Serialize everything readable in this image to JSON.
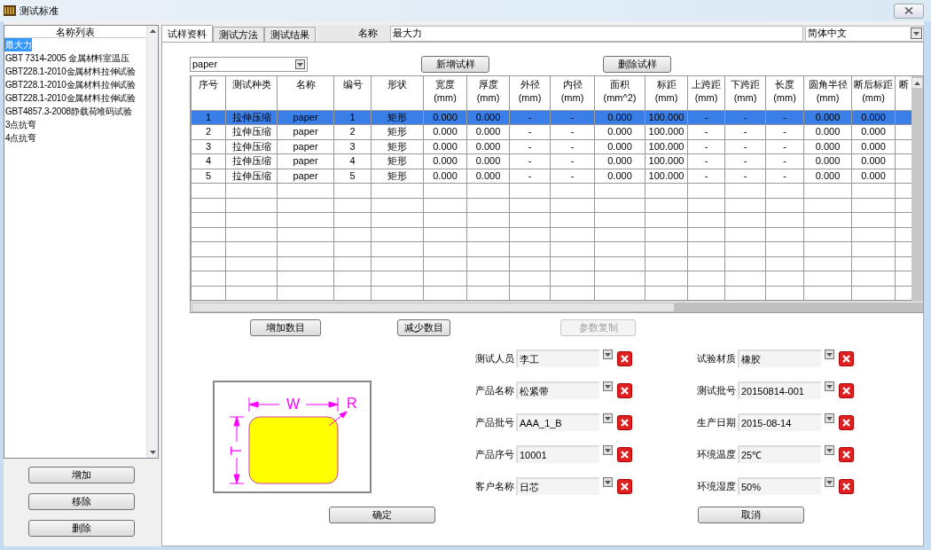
{
  "window": {
    "title": "测试标准"
  },
  "name_list": {
    "header": "名称列表",
    "items": [
      {
        "label": "最大力",
        "selected": true
      },
      {
        "label": "GBT 7314-2005 金属材料室温压",
        "selected": false
      },
      {
        "label": "GBT228.1-2010金属材料拉伸试验",
        "selected": false
      },
      {
        "label": "GBT228.1-2010金属材料拉伸试验",
        "selected": false
      },
      {
        "label": "GBT228.1-2010金属材料拉伸试验",
        "selected": false
      },
      {
        "label": "GBT4857.3-2008静载荷堆码试验",
        "selected": false
      },
      {
        "label": "3点抗弯",
        "selected": false
      },
      {
        "label": "4点抗弯",
        "selected": false
      }
    ]
  },
  "side_buttons": [
    "增加",
    "移除",
    "删除"
  ],
  "tabs": [
    {
      "label": "试样资料",
      "selected": true
    },
    {
      "label": "测试方法",
      "selected": false
    },
    {
      "label": "测试结果",
      "selected": false
    }
  ],
  "name_field": {
    "label": "名称",
    "value": "最大力"
  },
  "language": {
    "value": "简体中文"
  },
  "sample_select": {
    "value": "paper"
  },
  "sample_buttons": [
    "新增试样",
    "删除试样"
  ],
  "table": {
    "columns": [
      {
        "label": "序号"
      },
      {
        "label": "测试种类"
      },
      {
        "label": "名称"
      },
      {
        "label": "编号"
      },
      {
        "label": "形状"
      },
      {
        "label": "宽度",
        "unit": "(mm)"
      },
      {
        "label": "厚度",
        "unit": "(mm)"
      },
      {
        "label": "外径",
        "unit": "(mm)"
      },
      {
        "label": "内径",
        "unit": "(mm)"
      },
      {
        "label": "面积",
        "unit": "(mm^2)"
      },
      {
        "label": "标距",
        "unit": "(mm)"
      },
      {
        "label": "上跨距",
        "unit": "(mm)"
      },
      {
        "label": "下跨距",
        "unit": "(mm)"
      },
      {
        "label": "长度",
        "unit": "(mm)"
      },
      {
        "label": "圆角半径",
        "unit": "(mm)"
      },
      {
        "label": "断后标距",
        "unit": "(mm)"
      },
      {
        "label": "断"
      }
    ],
    "rows": [
      {
        "selected": true,
        "cells": [
          "1",
          "拉伸压缩",
          "paper",
          "1",
          "矩形",
          "0.000",
          "0.000",
          "-",
          "-",
          "0.000",
          "100.000",
          "-",
          "-",
          "-",
          "0.000",
          "0.000"
        ]
      },
      {
        "selected": false,
        "cells": [
          "2",
          "拉伸压缩",
          "paper",
          "2",
          "矩形",
          "0.000",
          "0.000",
          "-",
          "-",
          "0.000",
          "100.000",
          "-",
          "-",
          "-",
          "0.000",
          "0.000"
        ]
      },
      {
        "selected": false,
        "cells": [
          "3",
          "拉伸压缩",
          "paper",
          "3",
          "矩形",
          "0.000",
          "0.000",
          "-",
          "-",
          "0.000",
          "100.000",
          "-",
          "-",
          "-",
          "0.000",
          "0.000"
        ]
      },
      {
        "selected": false,
        "cells": [
          "4",
          "拉伸压缩",
          "paper",
          "4",
          "矩形",
          "0.000",
          "0.000",
          "-",
          "-",
          "0.000",
          "100.000",
          "-",
          "-",
          "-",
          "0.000",
          "0.000"
        ]
      },
      {
        "selected": false,
        "cells": [
          "5",
          "拉伸压缩",
          "paper",
          "5",
          "矩形",
          "0.000",
          "0.000",
          "-",
          "-",
          "0.000",
          "100.000",
          "-",
          "-",
          "-",
          "0.000",
          "0.000"
        ]
      }
    ]
  },
  "row_buttons": [
    {
      "label": "增加数目",
      "disabled": false
    },
    {
      "label": "减少数目",
      "disabled": false
    },
    {
      "label": "参数复制",
      "disabled": true
    }
  ],
  "diagram": {
    "labels": [
      "W",
      "T",
      "R"
    ]
  },
  "fields_left": [
    {
      "label": "测试人员",
      "value": "李工"
    },
    {
      "label": "产品名称",
      "value": "松紧带"
    },
    {
      "label": "产品批号",
      "value": "AAA_1_B"
    },
    {
      "label": "产品序号",
      "value": "10001"
    },
    {
      "label": "客户名称",
      "value": "日芯"
    }
  ],
  "fields_right": [
    {
      "label": "试验材质",
      "value": "橡胶"
    },
    {
      "label": "测试批号",
      "value": "20150814-001"
    },
    {
      "label": "生产日期",
      "value": "2015-08-14"
    },
    {
      "label": "环境温度",
      "value": "25℃"
    },
    {
      "label": "环境湿度",
      "value": "50%"
    }
  ],
  "footer_buttons": [
    "确定",
    "取消"
  ]
}
